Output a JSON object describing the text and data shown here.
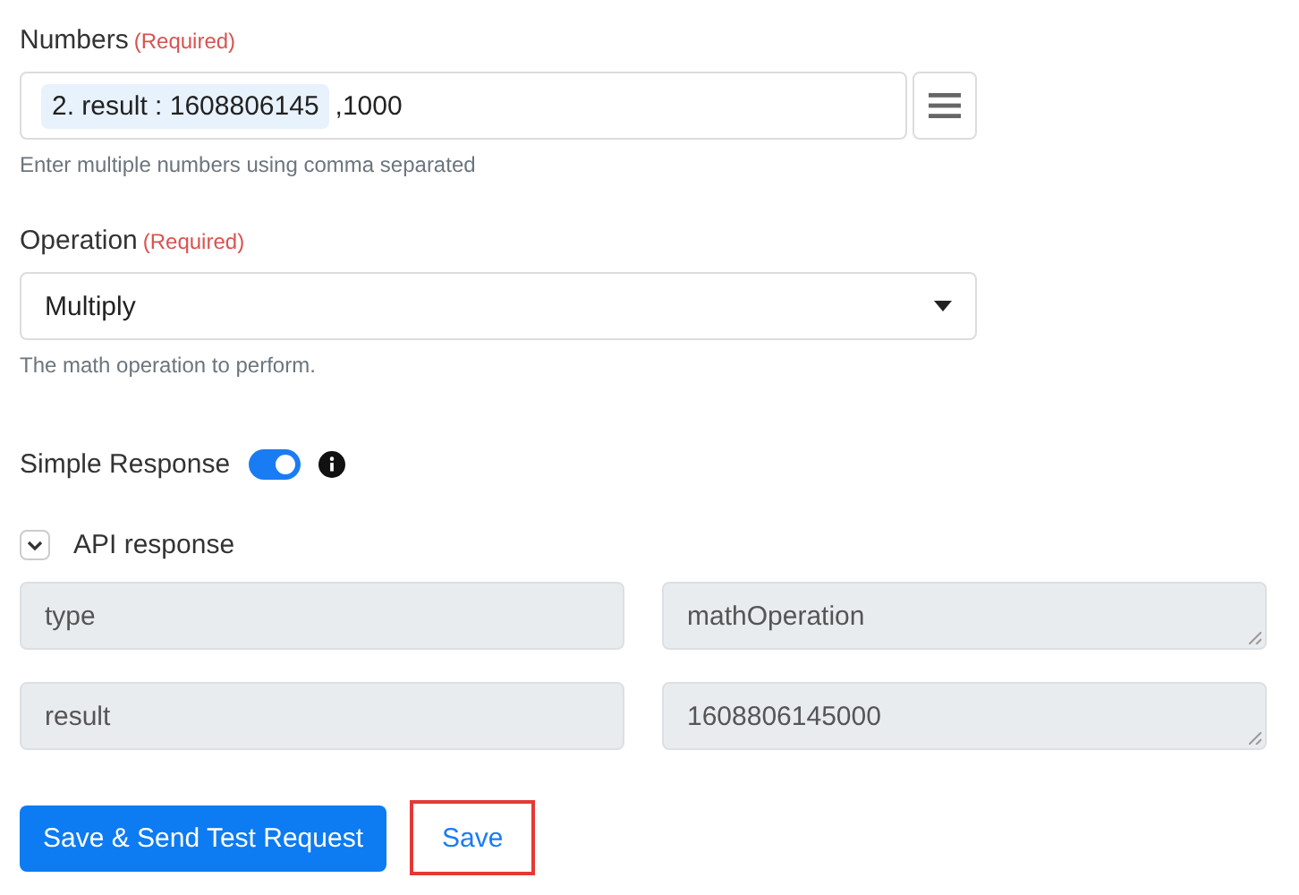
{
  "numbers_field": {
    "label": "Numbers",
    "required_note": "(Required)",
    "token": "2. result : 1608806145",
    "value": ",1000",
    "help": "Enter multiple numbers using comma separated"
  },
  "operation_field": {
    "label": "Operation",
    "required_note": "(Required)",
    "value": "Multiply",
    "help": "The math operation to perform."
  },
  "simple_response": {
    "label": "Simple Response",
    "on": true
  },
  "api_response": {
    "label": "API response",
    "expanded": true,
    "rows": [
      {
        "key": "type",
        "value": "mathOperation"
      },
      {
        "key": "result",
        "value": "1608806145000"
      }
    ]
  },
  "buttons": [
    {
      "label": "Save & Send Test Request",
      "kind": "primary",
      "highlighted": false
    },
    {
      "label": "Save",
      "kind": "link",
      "highlighted": true
    }
  ]
}
